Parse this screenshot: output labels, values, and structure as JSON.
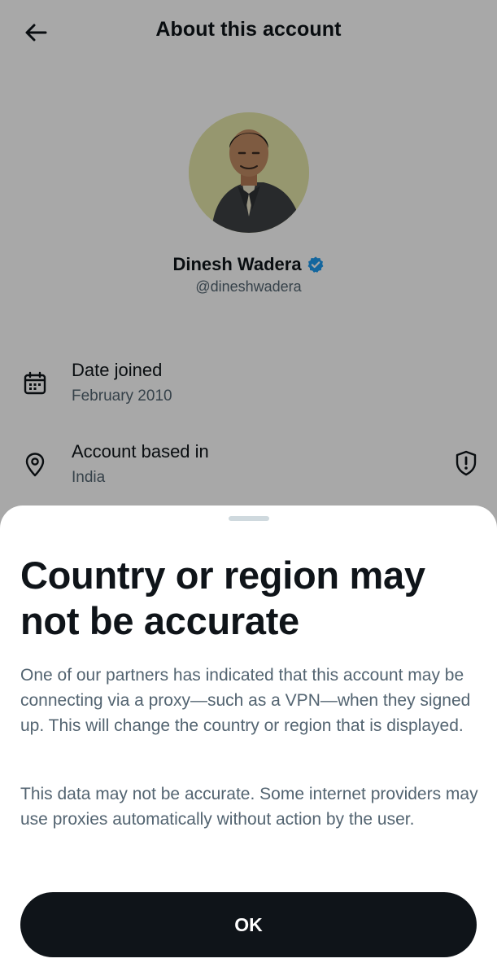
{
  "header": {
    "title": "About this account",
    "back_icon": "arrow-left-icon"
  },
  "profile": {
    "display_name": "Dinesh Wadera",
    "handle": "@dineshwadera",
    "verified": true,
    "verified_color": "#1d9bf0"
  },
  "info_rows": [
    {
      "icon": "calendar-icon",
      "label": "Date joined",
      "value": "February 2010"
    },
    {
      "icon": "location-pin-icon",
      "label": "Account based in",
      "value": "India",
      "action_icon": "shield-alert-icon"
    }
  ],
  "sheet": {
    "title": "Country or region may not be accurate",
    "paragraphs": [
      "One of our partners has indicated that this account may be connecting via a proxy—such as a VPN—when they signed up. This will change the country or region that is displayed.",
      "This data may not be accurate. Some internet providers may use proxies automatically without action by the user."
    ],
    "ok_label": "OK"
  },
  "colors": {
    "text_primary": "#0f1419",
    "text_secondary": "#536471",
    "button_bg": "#0f1419",
    "button_text": "#ffffff",
    "overlay": "rgba(0,0,0,0.34)"
  }
}
